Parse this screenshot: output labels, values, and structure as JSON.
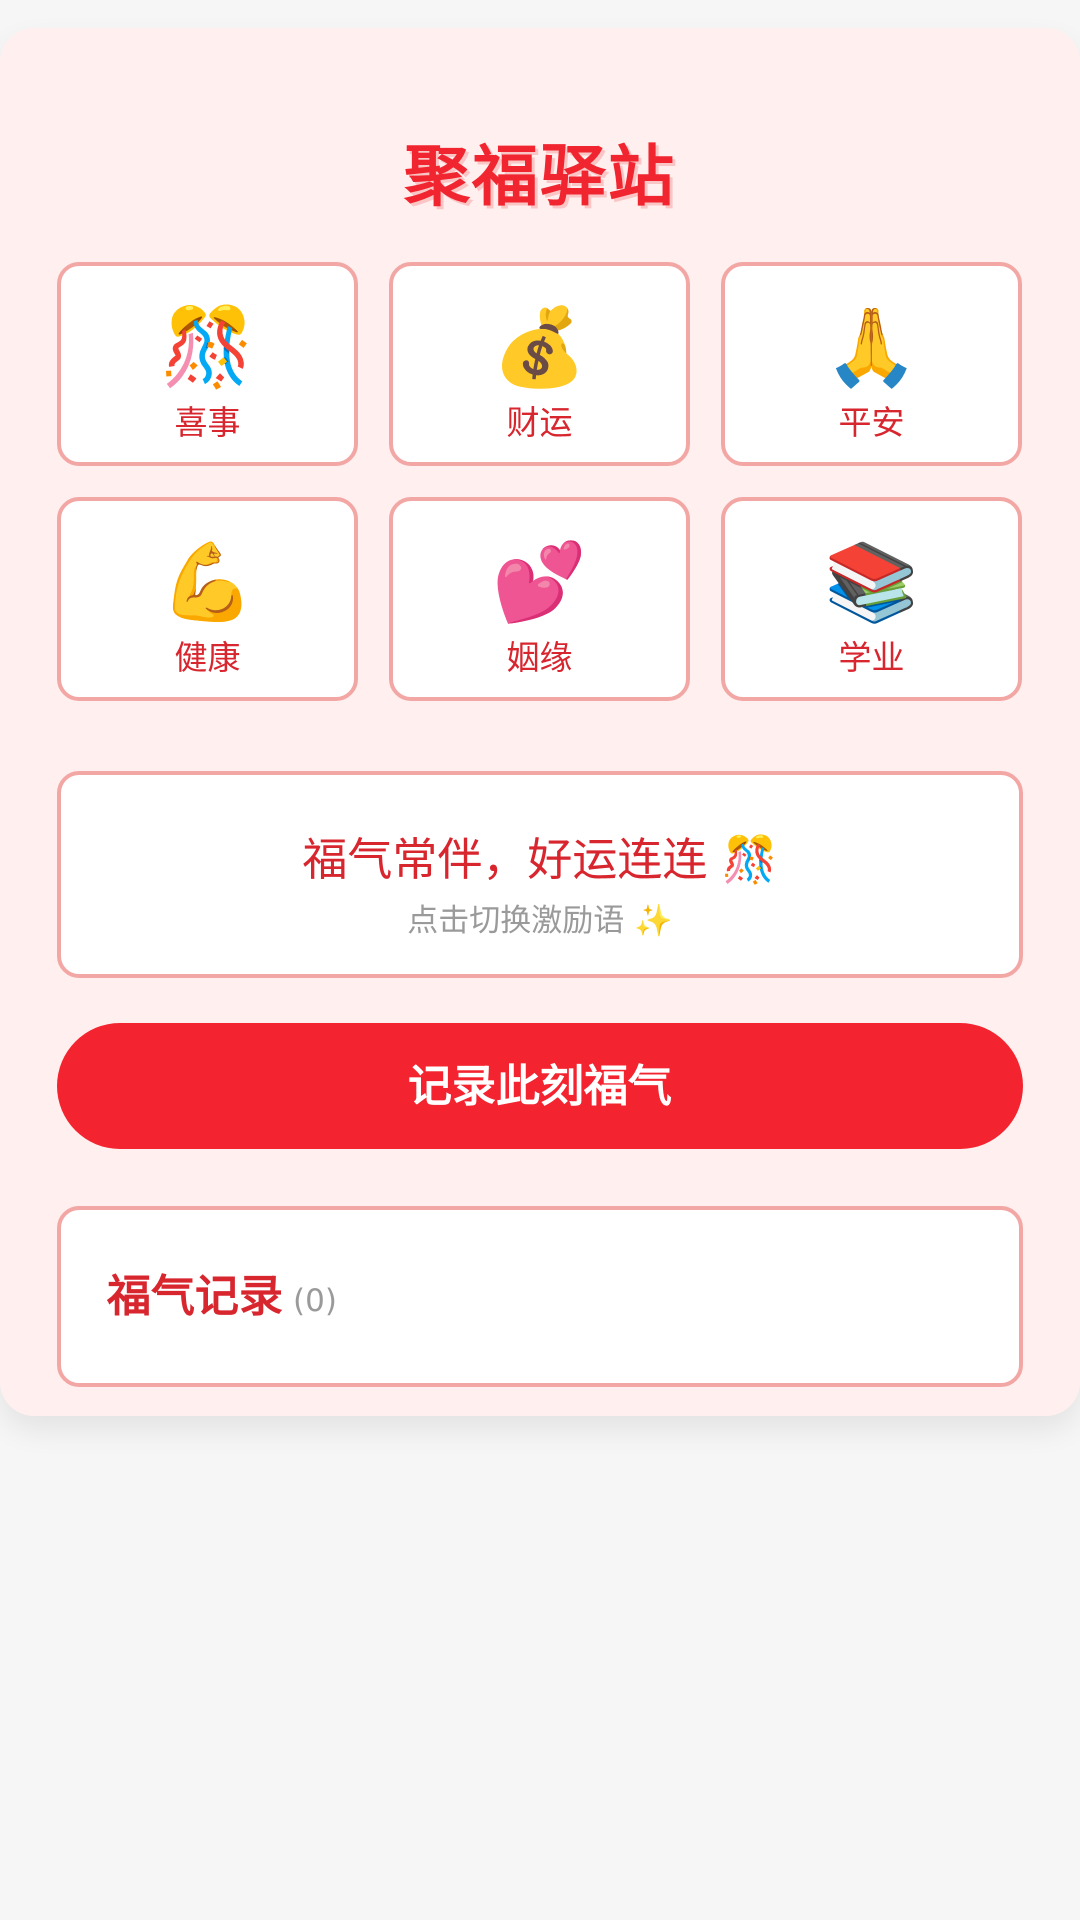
{
  "app": {
    "title": "聚福驿站"
  },
  "categories": [
    {
      "emoji": "🎊",
      "label": "喜事",
      "icon": "confetti-ball-icon"
    },
    {
      "emoji": "💰",
      "label": "财运",
      "icon": "money-bag-icon"
    },
    {
      "emoji": "🙏",
      "label": "平安",
      "icon": "praying-hands-icon"
    },
    {
      "emoji": "💪",
      "label": "健康",
      "icon": "flexed-biceps-icon"
    },
    {
      "emoji": "💕",
      "label": "姻缘",
      "icon": "two-hearts-icon"
    },
    {
      "emoji": "📚",
      "label": "学业",
      "icon": "books-icon"
    }
  ],
  "quote": {
    "text": "福气常伴，好运连连 🎊",
    "hint": "点击切换激励语 ✨"
  },
  "record_button": {
    "label": "记录此刻福气"
  },
  "history": {
    "title": "福气记录",
    "count": "(0)"
  },
  "colors": {
    "accent": "#f3242f",
    "text_red": "#d8262f",
    "card_bg": "#fff0ef",
    "border": "#f2a7a5",
    "page_bg": "#f6f6f6"
  }
}
